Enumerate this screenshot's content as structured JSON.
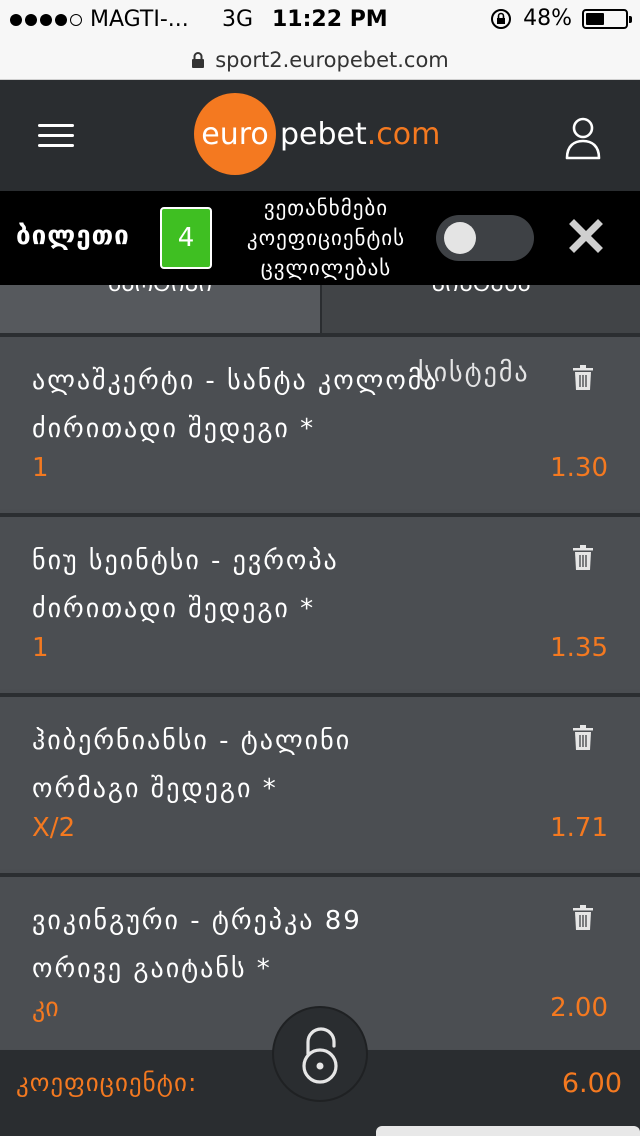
{
  "status_bar": {
    "carrier": "MAGTI-...",
    "network": "3G",
    "time": "11:22 PM",
    "battery": "48%",
    "battery_level": 0.48
  },
  "url_bar": {
    "url": "sport2.europebet.com"
  },
  "header": {
    "logo_circle": "euro",
    "logo_main": "pebet",
    "logo_suffix": ".com"
  },
  "ticket_bar": {
    "title": "ბილეთი",
    "count": "4",
    "accept_text_1": "ვეთანხმები",
    "accept_text_2": "კოეფიციენტის",
    "accept_text_3": "ცვლილებას",
    "toggle_on": false
  },
  "tabs": [
    {
      "label": "ᲛᲐᲠᲢᲘᲕᲘ"
    },
    {
      "label": "ᲡᲘᲡᲢᲔᲛᲐ"
    }
  ],
  "overlay_text": "სისტემა",
  "bets": [
    {
      "match": "ალაშკერტი - სანტა კოლომა",
      "market": "ძირითადი შედეგი *",
      "outcome": "1",
      "odds": "1.30"
    },
    {
      "match": "ნიუ სეინტსი - ევროპა",
      "market": "ძირითადი შედეგი *",
      "outcome": "1",
      "odds": "1.35"
    },
    {
      "match": "ჰიბერნიანსი - ტალინი",
      "market": "ორმაგი შედეგი *",
      "outcome": "X/2",
      "odds": "1.71"
    },
    {
      "match": "ვიკინგური - ტრეპკა 89",
      "market": "ორივე გაიტანს *",
      "outcome": "კი",
      "odds": "2.00"
    }
  ],
  "footer": {
    "coef_label": "კოეფიციენტი:",
    "coef_value": "6.00"
  },
  "colors": {
    "accent": "#f47920",
    "header_bg": "#2a2d30",
    "bet_bg": "#4b4e52",
    "badge_green": "#3fbf22"
  },
  "icons": [
    "menu-icon",
    "user-icon",
    "lock-icon",
    "close-icon",
    "trash-icon",
    "padlock-icon"
  ]
}
